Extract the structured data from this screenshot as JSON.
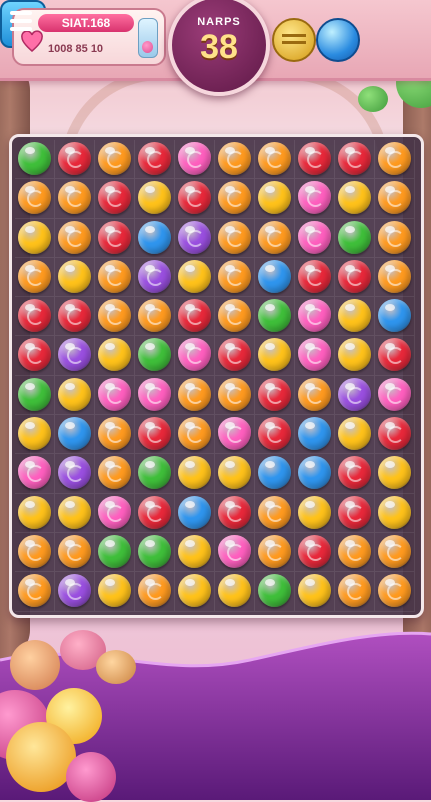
{
  "header": {
    "score_label": "SIAT.168",
    "score_value": "1008 85 10",
    "moves_title": "NARPS",
    "moves_value": "38"
  },
  "buttons": [
    "honey-pot-booster",
    "blue-orb-booster",
    "menu"
  ],
  "colors": {
    "green": "#3fbf3a",
    "red": "#e8283a",
    "orange": "#ff9a1f",
    "yellow": "#ffc21a",
    "pink": "#ff5fbf",
    "purple": "#9a4fe0",
    "blue": "#2f95ee",
    "board": "#463448",
    "purple_wave": "#7a2a8f"
  },
  "board": {
    "rows": 12,
    "cols": 10,
    "legend": {
      "G": "green round",
      "R": "red swirl",
      "O": "orange swirl",
      "Y": "yellow round",
      "P": "pink heart",
      "V": "purple swirl",
      "B": "blue round"
    },
    "grid": [
      "GRORPOORRO",
      "OORYROYPYO",
      "YORBVOOPGO",
      "OYOVYOBRRO",
      "RROOROGPYB",
      "RVYGPRYPYR",
      "GYPPOOROVP",
      "YBOROPRBYR",
      "PVOGYYBBRY",
      "YYPRBROYRY",
      "OOGGYPOROO",
      "OVYOYYGYOO"
    ]
  }
}
